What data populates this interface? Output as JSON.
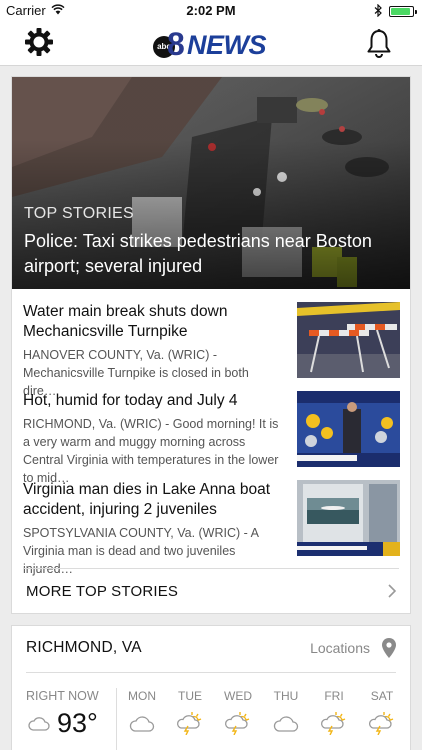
{
  "status_bar": {
    "carrier": "Carrier",
    "time": "2:02 PM",
    "battery_level": 0.9
  },
  "navbar": {
    "settings_icon": "gear-icon",
    "notifications_icon": "bell-icon",
    "logo": {
      "abc": "abc",
      "eight": "8",
      "news": "NEWS"
    }
  },
  "top_stories": {
    "section_label": "TOP STORIES",
    "featured_headline": "Police: Taxi strikes pedestrians near Boston airport; several injured",
    "stories": [
      {
        "title": "Water main break shuts down Mechanicsville Turnpike",
        "summary": "HANOVER COUNTY, Va. (WRIC) - Mechanicsville Turnpike is closed in both dire…"
      },
      {
        "title": "Hot, humid for today and July 4",
        "summary": "RICHMOND, Va. (WRIC) - Good morning! It is a very warm and muggy morning across Central Virginia with temperatures in the lower to mid…"
      },
      {
        "title": "Virginia man dies in Lake Anna boat accident, injuring 2 juveniles",
        "summary": "SPOTSYLVANIA COUNTY, Va. (WRIC) - A Virginia man is dead and two juveniles injured…"
      }
    ],
    "more_label": "MORE TOP STORIES"
  },
  "weather": {
    "city": "RICHMOND, VA",
    "locations_label": "Locations",
    "now": {
      "label": "RIGHT NOW",
      "temp": "93°",
      "icon": "cloud-icon"
    },
    "days": [
      {
        "label": "MON",
        "icon": "cloud-icon"
      },
      {
        "label": "TUE",
        "icon": "thunderstorm-icon"
      },
      {
        "label": "WED",
        "icon": "thunderstorm-icon"
      },
      {
        "label": "THU",
        "icon": "cloud-icon"
      },
      {
        "label": "FRI",
        "icon": "thunderstorm-icon"
      },
      {
        "label": "SAT",
        "icon": "thunderstorm-icon"
      }
    ]
  },
  "colors": {
    "brand_blue": "#1c3f9a",
    "thunder_yellow": "#f2b619",
    "icon_gray": "#9a9a9a"
  }
}
